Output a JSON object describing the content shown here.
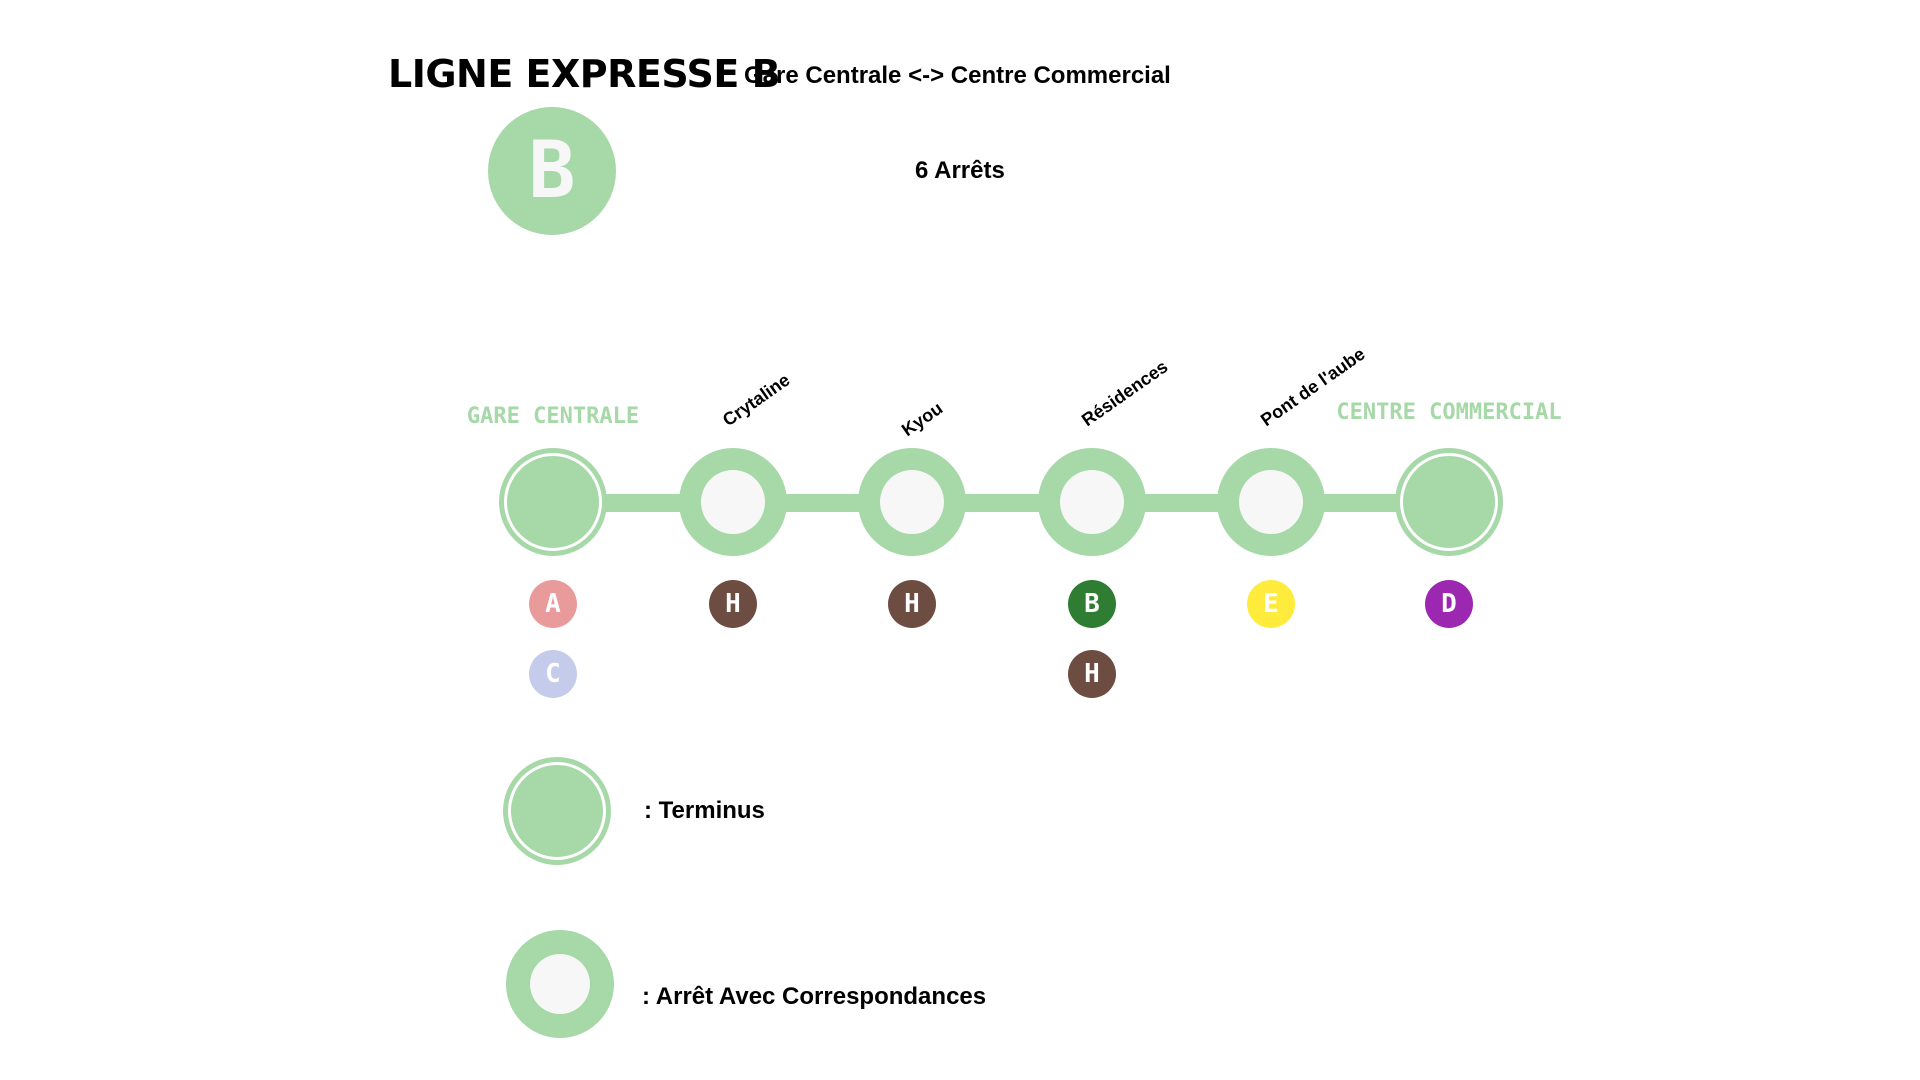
{
  "header": {
    "title": "LIGNE EXPRESSE B",
    "route": "Gare Centrale <-> Centre Commercial",
    "stops_count": "6 Arrêts",
    "line_badge": "B"
  },
  "colors": {
    "line": "#a6d8a8",
    "stop_fill": "#f7f7f7"
  },
  "stations": [
    {
      "name": "GARE CENTRALE",
      "type": "terminus",
      "connections": [
        {
          "line": "A",
          "color": "#e99a9a"
        },
        {
          "line": "C",
          "color": "#c5cbea"
        }
      ]
    },
    {
      "name": "Crytaline",
      "type": "correspondance",
      "connections": [
        {
          "line": "H",
          "color": "#6d4c41"
        }
      ]
    },
    {
      "name": "Kyou",
      "type": "correspondance",
      "connections": [
        {
          "line": "H",
          "color": "#6d4c41"
        }
      ]
    },
    {
      "name": "Résidences",
      "type": "correspondance",
      "connections": [
        {
          "line": "B",
          "color": "#2e7d32"
        },
        {
          "line": "H",
          "color": "#6d4c41"
        }
      ]
    },
    {
      "name": "Pont de l'aube",
      "type": "correspondance",
      "connections": [
        {
          "line": "E",
          "color": "#ffeb3b"
        }
      ]
    },
    {
      "name": "CENTRE COMMERCIAL",
      "type": "terminus",
      "connections": [
        {
          "line": "D",
          "color": "#9c27b0"
        }
      ]
    }
  ],
  "legend": {
    "terminus": ": Terminus",
    "correspondance": ": Arrêt Avec Correspondances"
  }
}
